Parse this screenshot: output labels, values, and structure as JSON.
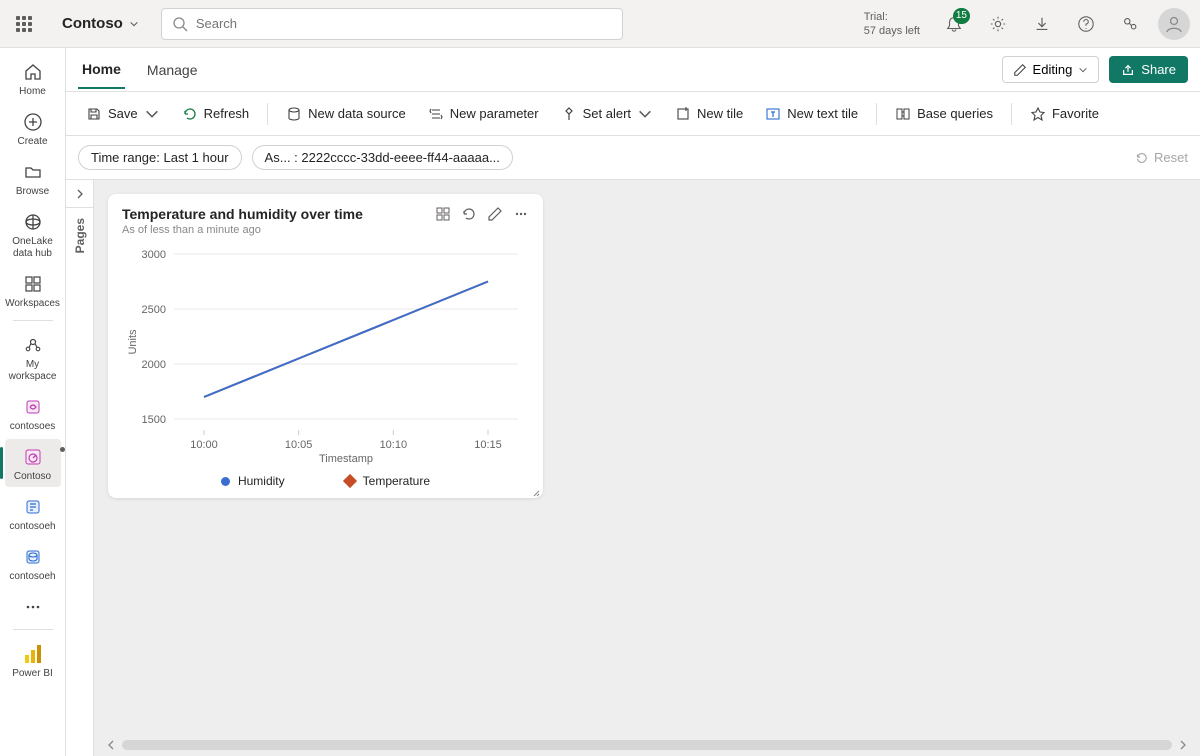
{
  "header": {
    "brand": "Contoso",
    "search_placeholder": "Search",
    "trial_label": "Trial:",
    "trial_days": "57 days left",
    "notification_count": "15"
  },
  "nav": {
    "items": [
      {
        "label": "Home"
      },
      {
        "label": "Create"
      },
      {
        "label": "Browse"
      },
      {
        "label": "OneLake data hub"
      },
      {
        "label": "Workspaces"
      },
      {
        "label": "My workspace"
      },
      {
        "label": "contosoes"
      },
      {
        "label": "Contoso"
      },
      {
        "label": "contosoeh"
      },
      {
        "label": "contosoeh"
      },
      {
        "label": "Power BI"
      }
    ]
  },
  "tabs": {
    "home": "Home",
    "manage": "Manage",
    "editing": "Editing",
    "share": "Share"
  },
  "toolbar": {
    "save": "Save",
    "refresh": "Refresh",
    "new_data_source": "New data source",
    "new_parameter": "New parameter",
    "set_alert": "Set alert",
    "new_tile": "New tile",
    "new_text_tile": "New text tile",
    "base_queries": "Base queries",
    "favorite": "Favorite"
  },
  "filters": {
    "time_range": "Time range: Last 1 hour",
    "asset": "As... : 2222cccc-33dd-eeee-ff44-aaaaa...",
    "reset": "Reset"
  },
  "pages_label": "Pages",
  "tile": {
    "title": "Temperature and humidity over time",
    "subtitle": "As of less than a minute ago",
    "ylabel": "Units",
    "xlabel": "Timestamp",
    "legend_humidity": "Humidity",
    "legend_temperature": "Temperature"
  },
  "chart_data": {
    "type": "line",
    "xlabel": "Timestamp",
    "ylabel": "Units",
    "categories": [
      "10:00",
      "10:05",
      "10:10",
      "10:15"
    ],
    "ylim": [
      1400,
      3000
    ],
    "y_ticks": [
      1500,
      2000,
      2500,
      3000
    ],
    "series": [
      {
        "name": "Temperature",
        "values": [
          1700,
          2050,
          2400,
          2750
        ],
        "color": "#c64d25"
      },
      {
        "name": "Humidity",
        "values": [
          1700,
          2050,
          2400,
          2750
        ],
        "color": "#3a6fcf"
      }
    ]
  }
}
